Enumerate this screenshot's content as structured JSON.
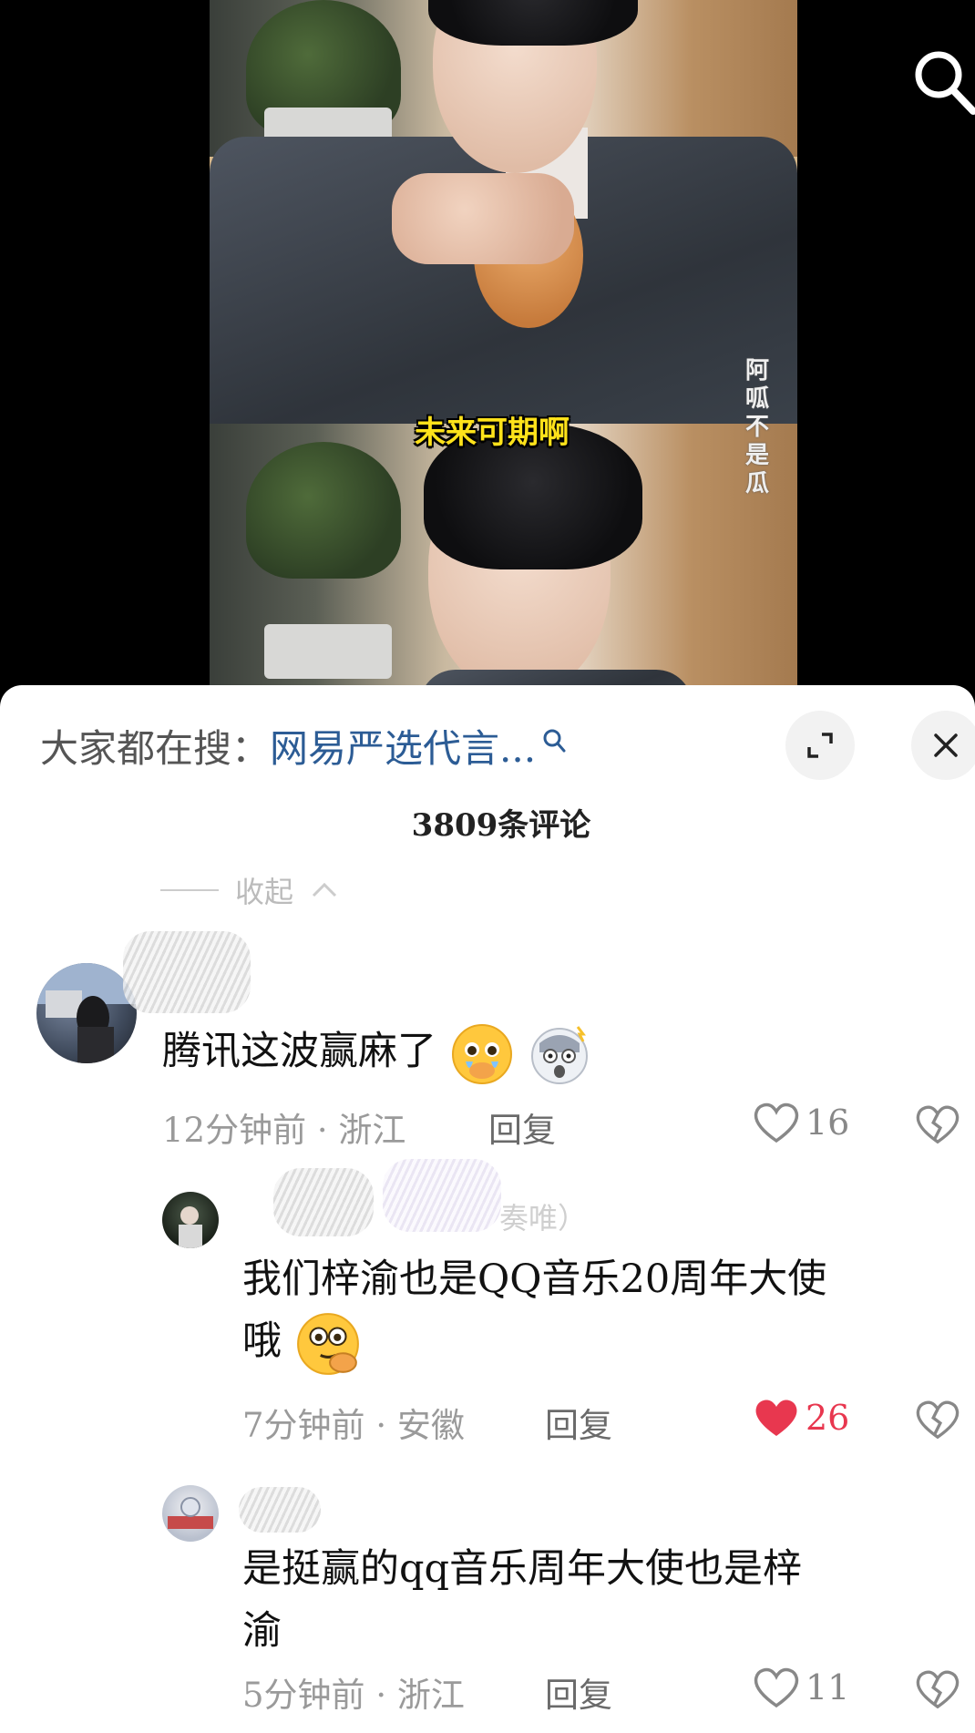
{
  "video": {
    "caption": "未来可期啊",
    "watermark": "阿呱不是瓜"
  },
  "panel": {
    "search_prefix": "大家都在搜：",
    "search_term": "网易严选代言...",
    "comment_count_title": "3809条评论",
    "collapse_label": "收起"
  },
  "comments": [
    {
      "text": "腾讯这波赢麻了",
      "emojis": [
        "pleading-crying-emoji",
        "shocked-emoji"
      ],
      "time": "12分钟前",
      "location": "浙江",
      "reply_label": "回复",
      "likes": "16",
      "liked": false
    },
    {
      "name_tail": "奏唯）",
      "text_line1": "我们梓渝也是QQ音乐20周年大使",
      "text_line2": "哦",
      "emojis": [
        "flushed-peek-emoji"
      ],
      "time": "7分钟前",
      "location": "安徽",
      "reply_label": "回复",
      "likes": "26",
      "liked": true,
      "accent": "#e8374f"
    },
    {
      "text_line1": "是挺赢的qq音乐周年大使也是梓",
      "text_line2": "渝",
      "time": "5分钟前",
      "location": "浙江",
      "reply_label": "回复",
      "likes": "11",
      "liked": false
    }
  ]
}
